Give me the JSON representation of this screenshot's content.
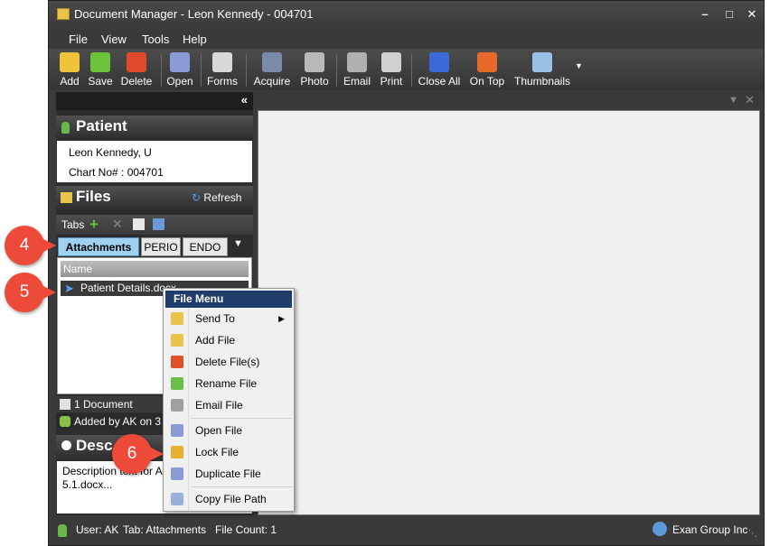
{
  "window": {
    "title": "Document Manager - Leon Kennedy - 004701"
  },
  "menu": [
    "File",
    "View",
    "Tools",
    "Help"
  ],
  "toolbar": [
    {
      "label": "Add",
      "icon": "add-folder-icon",
      "color": "#f0c43a"
    },
    {
      "label": "Save",
      "icon": "save-check-icon",
      "color": "#6cc23a"
    },
    {
      "label": "Delete",
      "icon": "delete-folder-icon",
      "color": "#e04a2a"
    },
    {
      "label": "Open",
      "icon": "open-door-icon",
      "color": "#8a9bd8"
    },
    {
      "label": "Forms",
      "icon": "forms-icon",
      "color": "#d8d8d8"
    },
    {
      "label": "Acquire",
      "icon": "scanner-icon",
      "color": "#7a8aa8"
    },
    {
      "label": "Photo",
      "icon": "camera-icon",
      "color": "#b8b8b8"
    },
    {
      "label": "Email",
      "icon": "email-icon",
      "color": "#b0b0b0"
    },
    {
      "label": "Print",
      "icon": "printer-icon",
      "color": "#d0d0d0"
    },
    {
      "label": "Close All",
      "icon": "close-all-icon",
      "color": "#3a6ad8"
    },
    {
      "label": "On Top",
      "icon": "pin-icon",
      "color": "#e86a2a"
    },
    {
      "label": "Thumbnails",
      "icon": "thumbnails-icon",
      "color": "#9ac0e8"
    }
  ],
  "patient": {
    "header": "Patient",
    "name": "Leon Kennedy,  U",
    "chart": "Chart No# : 004701"
  },
  "files": {
    "header": "Files",
    "refresh": "Refresh",
    "tabs_label": "Tabs",
    "tabs": [
      "Attachments",
      "PERIO",
      "ENDO"
    ],
    "column": "Name",
    "row": "Patient Details.docx",
    "doc_count": "1 Document",
    "added_by": "Added by AK on 3"
  },
  "description": {
    "header": "Desc",
    "text": "Description text for A... Book 5.1.docx..."
  },
  "status": {
    "user": "User: AK",
    "tab": "Tab:  Attachments",
    "count": "File Count:  1",
    "company": "Exan Group Inc"
  },
  "context_menu": {
    "title": "File Menu",
    "items": [
      {
        "label": "Send To",
        "icon": "folder-send-icon",
        "color": "#e8c44a"
      },
      {
        "label": "Add File",
        "icon": "add-file-icon",
        "color": "#e8c44a"
      },
      {
        "label": "Delete File(s)",
        "icon": "delete-file-icon",
        "color": "#e0502a"
      },
      {
        "label": "Rename File",
        "icon": "rename-file-icon",
        "color": "#6abf4a"
      },
      {
        "label": "Email File",
        "icon": "email-file-icon",
        "color": "#a0a0a0"
      },
      {
        "label": "Open File",
        "icon": "open-file-icon",
        "color": "#8a9bd8"
      },
      {
        "label": "Lock File",
        "icon": "lock-icon",
        "color": "#e8b030"
      },
      {
        "label": "Duplicate File",
        "icon": "duplicate-file-icon",
        "color": "#8a9bd8"
      },
      {
        "label": "Copy File Path",
        "icon": "copy-path-icon",
        "color": "#9ab0d8"
      }
    ]
  },
  "callouts": [
    "4",
    "5",
    "6"
  ],
  "colors": {
    "callout": "#ee4a3a",
    "menu_title_bg": "#1f3c6a",
    "active_tab": "#9ed0f0"
  }
}
